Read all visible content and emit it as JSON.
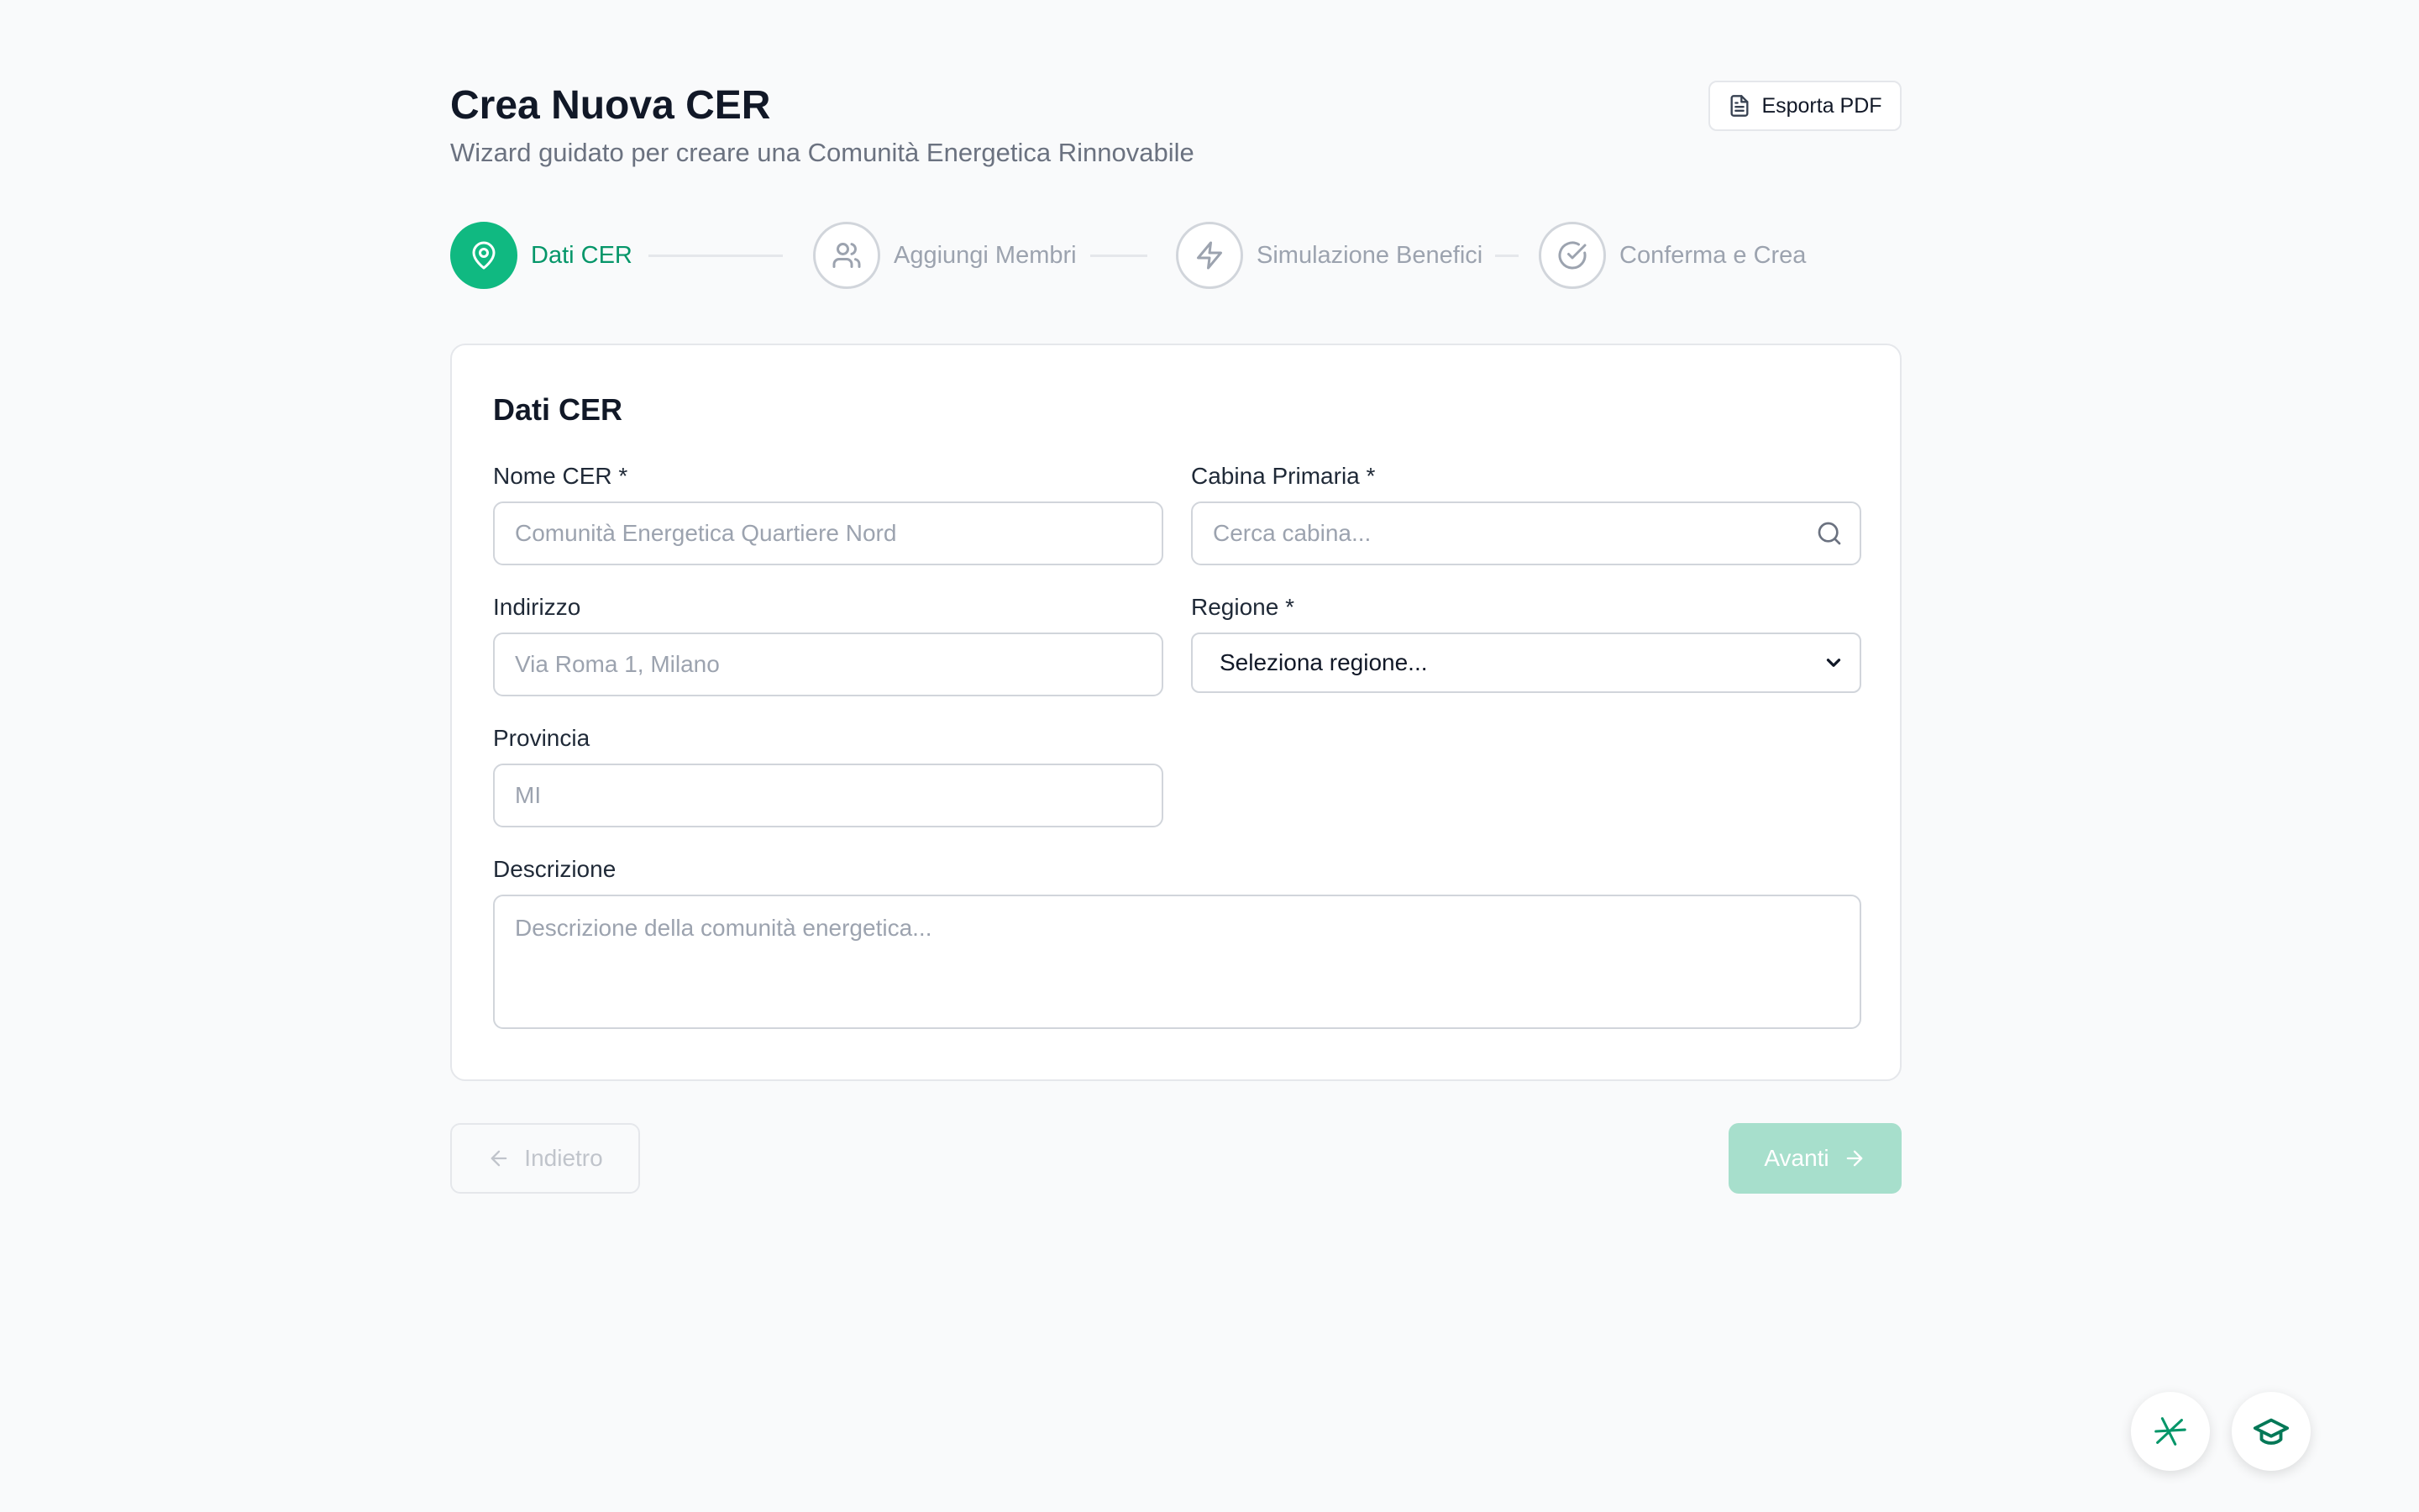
{
  "header": {
    "title": "Crea Nuova CER",
    "subtitle": "Wizard guidato per creare una Comunità Energetica Rinnovabile",
    "export_label": "Esporta PDF"
  },
  "steps": [
    {
      "label": "Dati CER",
      "icon": "map-pin-icon",
      "active": true
    },
    {
      "label": "Aggiungi Membri",
      "icon": "users-icon",
      "active": false
    },
    {
      "label": "Simulazione Benefici",
      "icon": "lightning-icon",
      "active": false
    },
    {
      "label": "Conferma e Crea",
      "icon": "check-circle-icon",
      "active": false
    }
  ],
  "form": {
    "title": "Dati CER",
    "nome": {
      "label": "Nome CER *",
      "placeholder": "Comunità Energetica Quartiere Nord"
    },
    "cabina": {
      "label": "Cabina Primaria *",
      "placeholder": "Cerca cabina..."
    },
    "indirizzo": {
      "label": "Indirizzo",
      "placeholder": "Via Roma 1, Milano"
    },
    "regione": {
      "label": "Regione *",
      "selected": "Seleziona regione..."
    },
    "provincia": {
      "label": "Provincia",
      "placeholder": "MI"
    },
    "descrizione": {
      "label": "Descrizione",
      "placeholder": "Descrizione della comunità energetica..."
    }
  },
  "nav": {
    "back_label": "Indietro",
    "next_label": "Avanti"
  },
  "colors": {
    "accent": "#10b981",
    "accent_text": "#059669",
    "next_disabled": "#a7dfcc"
  },
  "fabs": [
    {
      "icon": "sparkle-icon"
    },
    {
      "icon": "graduation-cap-icon"
    }
  ]
}
